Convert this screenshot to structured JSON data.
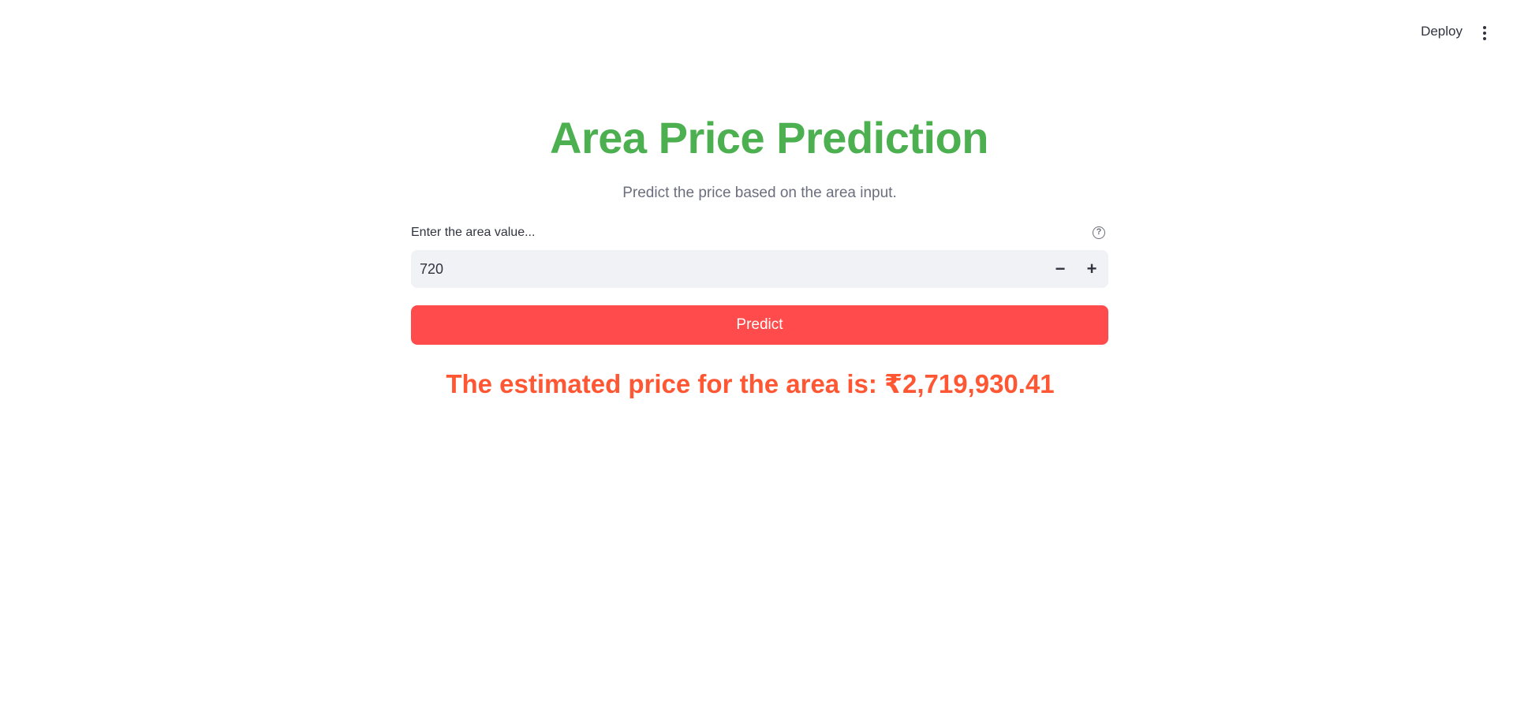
{
  "header": {
    "deploy_label": "Deploy",
    "menu_icon": "vertical-ellipsis-icon"
  },
  "main": {
    "title": "Area Price Prediction",
    "subtitle": "Predict the price based on the area input.",
    "input": {
      "label": "Enter the area value...",
      "value": "720",
      "help_icon": "question-circle-icon",
      "minus_label": "−",
      "plus_label": "+"
    },
    "predict_label": "Predict",
    "result_text": "The estimated price for the area is: ₹2,719,930.41"
  },
  "colors": {
    "title": "#4caf50",
    "button": "#ff4b4b",
    "result": "#ff5733",
    "input_bg": "#f0f2f6"
  }
}
